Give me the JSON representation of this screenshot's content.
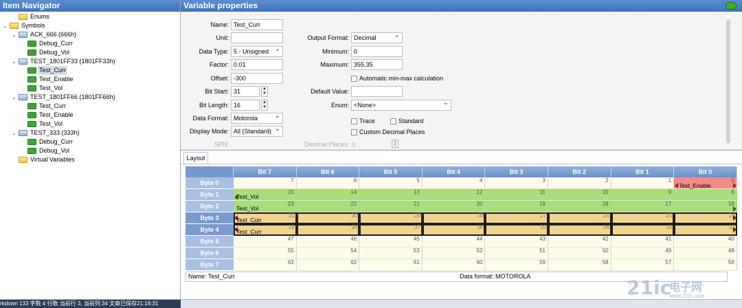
{
  "navigator": {
    "title": "Item Navigator",
    "tree": [
      {
        "label": "Enums",
        "icon": "folder-icon",
        "level": 1,
        "expander": ""
      },
      {
        "label": "Symbols",
        "icon": "folder-icon",
        "level": 0,
        "expander": "⌄"
      },
      {
        "label": "ACK_666 (666h)",
        "icon": "message-icon",
        "level": 1,
        "expander": "⌄"
      },
      {
        "label": "Debug_Curr",
        "icon": "signal-icon",
        "level": 2,
        "expander": ""
      },
      {
        "label": "Debug_Vol",
        "icon": "signal-icon",
        "level": 2,
        "expander": ""
      },
      {
        "label": "TEST_1801FF33 (1801FF33h)",
        "icon": "message-icon",
        "level": 1,
        "expander": "⌄"
      },
      {
        "label": "Test_Curr",
        "icon": "signal-icon",
        "level": 2,
        "expander": "",
        "selected": true
      },
      {
        "label": "Test_Enable",
        "icon": "signal-icon",
        "level": 2,
        "expander": ""
      },
      {
        "label": "Test_Vol",
        "icon": "signal-icon",
        "level": 2,
        "expander": ""
      },
      {
        "label": "TEST_1801FF66 (1801FF66h)",
        "icon": "message-icon",
        "level": 1,
        "expander": "⌄"
      },
      {
        "label": "Test_Curr",
        "icon": "signal-icon",
        "level": 2,
        "expander": ""
      },
      {
        "label": "Test_Enable",
        "icon": "signal-icon",
        "level": 2,
        "expander": ""
      },
      {
        "label": "Test_Vol",
        "icon": "signal-icon",
        "level": 2,
        "expander": ""
      },
      {
        "label": "TEST_333 (333h)",
        "icon": "message-icon",
        "level": 1,
        "expander": "⌄"
      },
      {
        "label": "Debug_Curr",
        "icon": "signal-icon",
        "level": 2,
        "expander": ""
      },
      {
        "label": "Debug_Vol",
        "icon": "signal-icon",
        "level": 2,
        "expander": ""
      },
      {
        "label": "Virtual Variables",
        "icon": "folder-icon",
        "level": 1,
        "expander": ""
      }
    ]
  },
  "props": {
    "title": "Variable properties",
    "name": {
      "label": "Name:",
      "value": "Test_Curr"
    },
    "unit": {
      "label": "Unit:",
      "value": ""
    },
    "data_type": {
      "label": "Data Type:",
      "value": "5 - Unsigned"
    },
    "factor": {
      "label": "Factor:",
      "value": "0.01"
    },
    "offset": {
      "label": "Offset:",
      "value": "-300"
    },
    "bit_start": {
      "label": "Bit Start:",
      "value": "31"
    },
    "bit_length": {
      "label": "Bit Length:",
      "value": "16"
    },
    "data_format": {
      "label": "Data Format:",
      "value": "Motorola"
    },
    "display_mode": {
      "label": "Display Mode:",
      "value": "All (Standard)"
    },
    "spn": {
      "label": "SPN:",
      "value": ""
    },
    "output_format": {
      "label": "Output Format:",
      "value": "Decimal"
    },
    "minimum": {
      "label": "Minimum:",
      "value": "0"
    },
    "maximum": {
      "label": "Maximum:",
      "value": "355.35"
    },
    "auto_minmax": {
      "label": "Automatic min-max calculation",
      "checked": false
    },
    "default_value": {
      "label": "Default Value:",
      "value": ""
    },
    "enum": {
      "label": "Enum:",
      "value": "<None>"
    },
    "trace": {
      "label": "Trace",
      "checked": false
    },
    "standard": {
      "label": "Standard",
      "checked": false
    },
    "custom_decimal": {
      "label": "Custom Decimal Places",
      "checked": false
    },
    "decimal_places": {
      "label": "Decimal Places:",
      "value": "0"
    }
  },
  "layout": {
    "tab_label": "Layout",
    "bit_headers": [
      "Bit 7",
      "Bit 6",
      "Bit 5",
      "Bit 4",
      "Bit 3",
      "Bit 2",
      "Bit 1",
      "Bit 0"
    ],
    "bytes": [
      {
        "label": "Byte 0",
        "bits": [
          "7",
          "6",
          "5",
          "4",
          "3",
          "2",
          "1",
          "0"
        ]
      },
      {
        "label": "Byte 1",
        "bits": [
          "15",
          "14",
          "13",
          "12",
          "11",
          "10",
          "9",
          "8"
        ]
      },
      {
        "label": "Byte 2",
        "bits": [
          "23",
          "22",
          "21",
          "20",
          "19",
          "18",
          "17",
          "16"
        ]
      },
      {
        "label": "Byte 3",
        "bits": [
          "31",
          "30",
          "29",
          "28",
          "27",
          "26",
          "25",
          "24"
        ]
      },
      {
        "label": "Byte 4",
        "bits": [
          "39",
          "38",
          "37",
          "36",
          "35",
          "34",
          "33",
          "32"
        ]
      },
      {
        "label": "Byte 5",
        "bits": [
          "47",
          "46",
          "45",
          "44",
          "43",
          "42",
          "41",
          "40"
        ]
      },
      {
        "label": "Byte 6",
        "bits": [
          "55",
          "54",
          "53",
          "52",
          "51",
          "50",
          "49",
          "48"
        ]
      },
      {
        "label": "Byte 7",
        "bits": [
          "63",
          "62",
          "61",
          "60",
          "59",
          "58",
          "57",
          "56"
        ]
      }
    ],
    "signal_labels": {
      "test_enable": "Test_Enable",
      "test_vol_1": "Test_Vol",
      "test_vol_2": "Test_Vol",
      "test_curr_1": "Test_Curr",
      "test_curr_2": "Test_Curr"
    },
    "colors": {
      "vol": "#a9dc7c",
      "curr": "#f0d48f",
      "enable": "#f48a8a"
    },
    "footer_name": "Name: Test_Curr",
    "footer_format": "Data format: MOTOROLA"
  },
  "status": {
    "text": "rkdown  133 字数  4 行数  当前行 3, 当前列 34  文章已保存21:18:31"
  },
  "watermark": {
    "num": "21ic",
    "cn": "电子网",
    "sub": "www.21ic.com"
  }
}
